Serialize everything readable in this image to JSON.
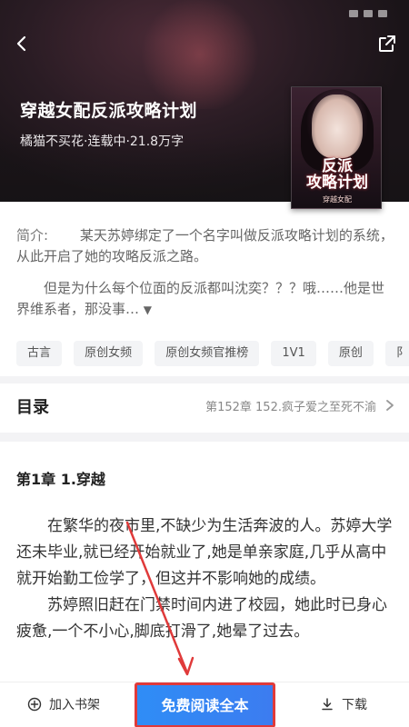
{
  "header": {
    "title": "穿越女配反派攻略计划",
    "meta": "橘猫不买花·连载中·21.8万字"
  },
  "cover": {
    "title_line1": "反派",
    "title_line2": "攻略计划",
    "subtitle": "穿越女配"
  },
  "intro": {
    "label": "简介:",
    "paragraph1": "某天苏婷绑定了一个名字叫做反派攻略计划的系统，从此开启了她的攻略反派之路。",
    "paragraph2": "但是为什么每个位面的反派都叫沈奕？？？哦……他是世界维系者，那没事…"
  },
  "tags": [
    "古言",
    "原创女频",
    "原创女频官推榜",
    "1V1",
    "原创",
    "阝"
  ],
  "toc": {
    "label": "目录",
    "latest": "第152章 152.疯子爱之至死不渝"
  },
  "chapter": {
    "title": "第1章 1.穿越",
    "paragraphs": [
      "在繁华的夜市里,不缺少为生活奔波的人。苏婷大学还未毕业,就已经开始就业了,她是单亲家庭,几乎从高中就开始勤工俭学了，但这并不影响她的成绩。",
      "苏婷照旧赶在门禁时间内进了校园，她此时已身心疲惫,一个不小心,脚底打滑了,她晕了过去。"
    ]
  },
  "bottom_bar": {
    "add_shelf": "加入书架",
    "read_free": "免费阅读全本",
    "download": "下载"
  },
  "colors": {
    "accent_blue": "#2f8df6",
    "annotation_red": "#e03a3a"
  }
}
